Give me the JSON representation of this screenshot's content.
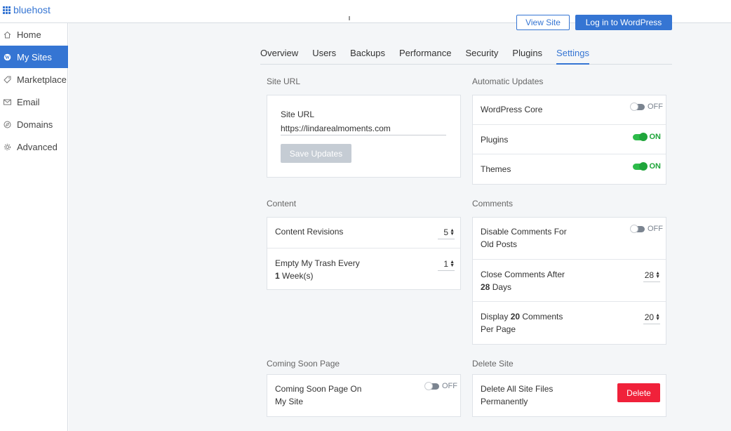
{
  "app": {
    "logo_text": "bluehost",
    "brand_color": "#3575d3"
  },
  "sidebar": {
    "items": [
      {
        "label": "Home",
        "icon": "home-icon"
      },
      {
        "label": "My Sites",
        "icon": "wordpress-icon",
        "active": true
      },
      {
        "label": "Marketplace",
        "icon": "tag-icon"
      },
      {
        "label": "Email",
        "icon": "mail-icon"
      },
      {
        "label": "Domains",
        "icon": "compass-icon"
      },
      {
        "label": "Advanced",
        "icon": "gear-icon"
      }
    ]
  },
  "header": {
    "view_site_label": "View Site",
    "login_label": "Log in to WordPress"
  },
  "tabs": [
    {
      "label": "Overview"
    },
    {
      "label": "Users"
    },
    {
      "label": "Backups"
    },
    {
      "label": "Performance"
    },
    {
      "label": "Security"
    },
    {
      "label": "Plugins"
    },
    {
      "label": "Settings",
      "active": true
    }
  ],
  "site_url": {
    "section_title": "Site URL",
    "field_label": "Site URL",
    "value": "https://lindarealmoments.com",
    "save_label": "Save Updates"
  },
  "automatic_updates": {
    "section_title": "Automatic Updates",
    "rows": [
      {
        "label": "WordPress Core",
        "state": "OFF"
      },
      {
        "label": "Plugins",
        "state": "ON"
      },
      {
        "label": "Themes",
        "state": "ON"
      }
    ]
  },
  "content": {
    "section_title": "Content",
    "revisions_label": "Content Revisions",
    "revisions_value": "5",
    "trash_label": "Empty My Trash Every",
    "trash_value_bold": "1",
    "trash_unit": " Week(s)",
    "trash_value": "1"
  },
  "comments": {
    "section_title": "Comments",
    "disable_label_1": "Disable Comments For",
    "disable_label_2": "Old Posts",
    "disable_state": "OFF",
    "close_label_1": "Close Comments After",
    "close_value_bold": "28",
    "close_unit": " Days",
    "close_value": "28",
    "display_prefix": "Display ",
    "display_value_bold": "20",
    "display_suffix": " Comments",
    "display_label_2": "Per Page",
    "display_value": "20"
  },
  "coming_soon": {
    "section_title": "Coming Soon Page",
    "label_1": "Coming Soon Page On",
    "label_2": "My Site",
    "state": "OFF"
  },
  "delete_site": {
    "section_title": "Delete Site",
    "label_1": "Delete All Site Files",
    "label_2": "Permanently",
    "delete_label": "Delete",
    "danger_color": "#f0213a"
  },
  "colors": {
    "toggle_on": "#1fa53a",
    "toggle_off": "#7b8490"
  }
}
